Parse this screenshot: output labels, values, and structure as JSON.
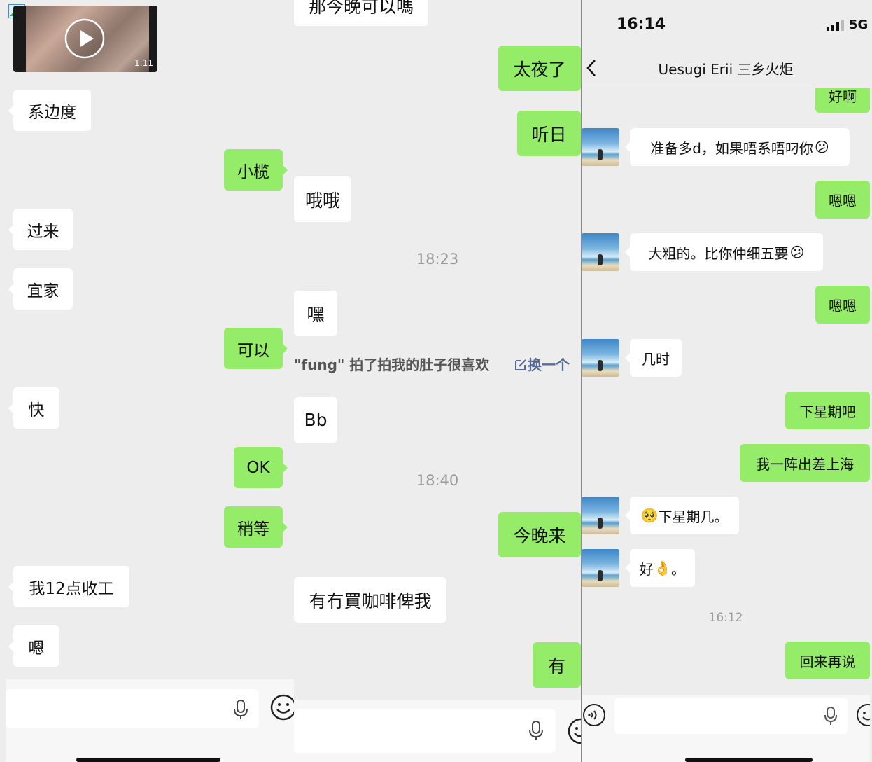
{
  "panel1": {
    "video": {
      "duration": "1:11"
    },
    "messages": [
      {
        "text": "系边度"
      },
      {
        "text": "小榄"
      },
      {
        "text": "过来"
      },
      {
        "text": "宜家"
      },
      {
        "text": "可以"
      },
      {
        "text": "快"
      },
      {
        "text": "OK"
      },
      {
        "text": "稍等"
      },
      {
        "text": "我12点收工"
      },
      {
        "text": "嗯"
      }
    ]
  },
  "panel2": {
    "messages": [
      {
        "text": "那今晚可以嗎"
      },
      {
        "text": "太夜了"
      },
      {
        "text": "听日"
      },
      {
        "text": "哦哦"
      },
      {
        "text": "嘿"
      },
      {
        "text": "Bb"
      },
      {
        "text": "今晚来"
      },
      {
        "text": "有冇買咖啡俾我"
      },
      {
        "text": "有"
      }
    ],
    "times": [
      "18:23",
      "18:40"
    ],
    "pat_notice": {
      "text": "\"fung\" 拍了拍我的肚子很喜欢",
      "action": "换一个"
    }
  },
  "panel3": {
    "status_bar": {
      "time": "16:14",
      "network": "5G"
    },
    "header": {
      "title": "Uesugi Erii 三乡火炬"
    },
    "messages": [
      {
        "text": "好啊"
      },
      {
        "text": "准备多d，如果唔系唔叼你"
      },
      {
        "text": "嗯嗯"
      },
      {
        "text": "大粗的。比你仲细五要"
      },
      {
        "text": "嗯嗯"
      },
      {
        "text": "几时"
      },
      {
        "text": "下星期吧"
      },
      {
        "text": "我一阵出差上海"
      },
      {
        "text": "下星期几。"
      },
      {
        "text": "好"
      },
      {
        "text": "回来再说"
      }
    ],
    "times": [
      "16:12"
    ]
  },
  "colors": {
    "green_bubble": "#95ec69",
    "white_bubble": "#ffffff",
    "background": "#ededed",
    "link_blue": "#576b95"
  },
  "icons": [
    "image-icon",
    "play-icon",
    "microphone-icon",
    "emoji-icon",
    "back-chevron-icon",
    "signal-icon",
    "voice-icon",
    "emoji-emoji"
  ]
}
